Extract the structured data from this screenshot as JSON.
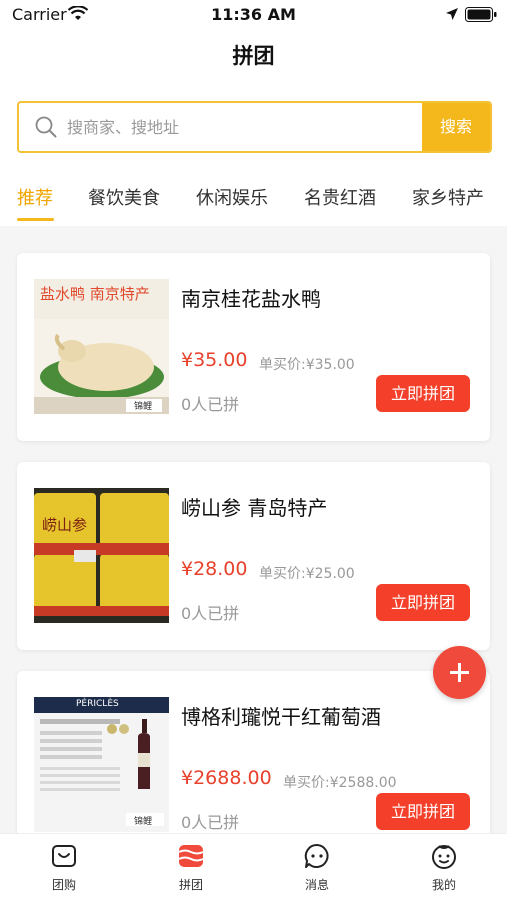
{
  "status_bar": {
    "carrier": "Carrier",
    "time": "11:36 AM"
  },
  "nav": {
    "title": "拼团"
  },
  "search": {
    "placeholder": "搜商家、搜地址",
    "button_label": "搜索"
  },
  "tabs": [
    {
      "label": "推荐",
      "active": true
    },
    {
      "label": "餐饮美食",
      "active": false
    },
    {
      "label": "休闲娱乐",
      "active": false
    },
    {
      "label": "名贵红酒",
      "active": false
    },
    {
      "label": "家乡特产",
      "active": false
    }
  ],
  "products": [
    {
      "name": "南京桂花盐水鸭",
      "price": "¥35.00",
      "single_price": "单买价:¥35.00",
      "joined": "0人已拼",
      "button": "立即拼团",
      "image_caption": "盐水鸭 南京特产",
      "image_badge": "锦鲤"
    },
    {
      "name": "崂山参 青岛特产",
      "price": "¥28.00",
      "single_price": "单买价:¥25.00",
      "joined": "0人已拼",
      "button": "立即拼团",
      "image_caption": "崂山参"
    },
    {
      "name": "博格利瓏悦干红葡萄酒",
      "price": "¥2688.00",
      "single_price": "单买价:¥2588.00",
      "joined": "0人已拼",
      "button": "立即拼团",
      "image_caption": "PÉRICLÈS",
      "image_badge": "锦鲤"
    }
  ],
  "bottom_tabs": [
    {
      "label": "团购",
      "icon": "bag-icon",
      "active": false
    },
    {
      "label": "拼团",
      "icon": "group-icon",
      "active": true
    },
    {
      "label": "消息",
      "icon": "chat-icon",
      "active": false
    },
    {
      "label": "我的",
      "icon": "smile-icon",
      "active": false
    }
  ],
  "colors": {
    "accent_yellow": "#f5b81c",
    "price_red": "#e8412c",
    "button_red": "#f4402a",
    "fab_red": "#f04a3d"
  }
}
